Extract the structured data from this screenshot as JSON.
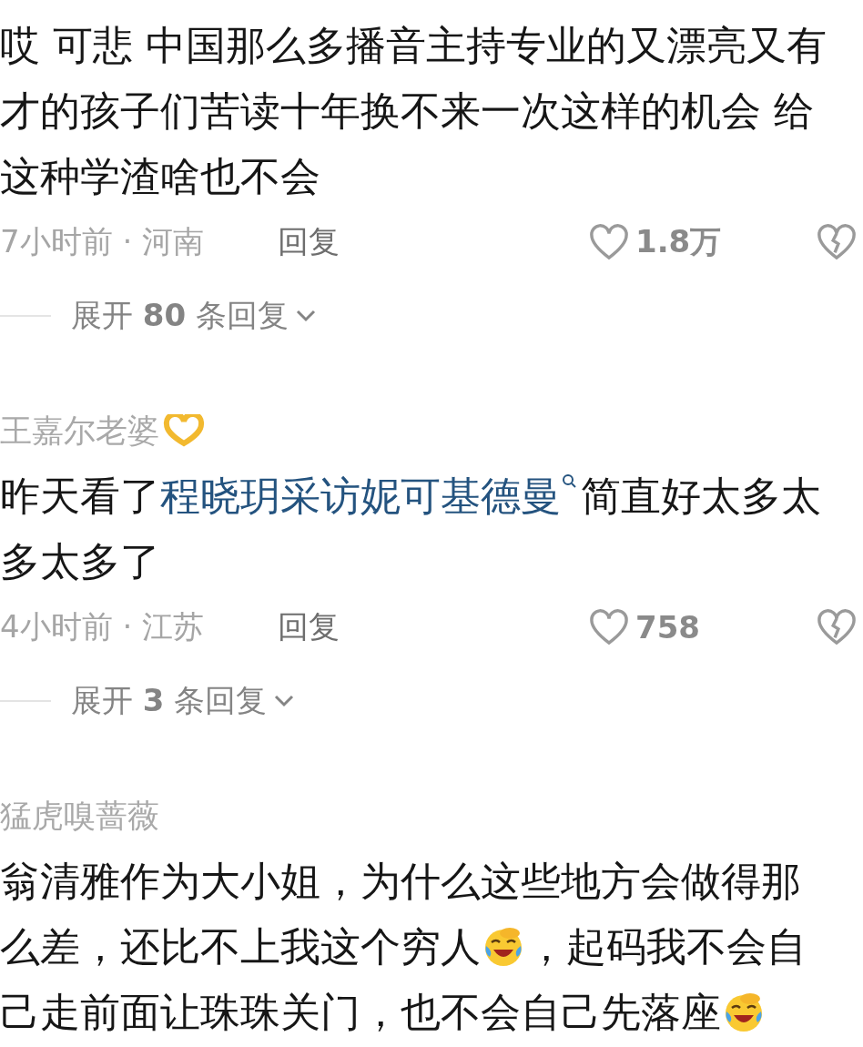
{
  "comments": [
    {
      "lines": [
        [
          {
            "kind": "text",
            "text": "哎 可悲 中国那么多播音主持专业的又漂亮又有"
          }
        ],
        [
          {
            "kind": "text",
            "text": "才的孩子们苦读十年换不来一次这样的机会 给"
          }
        ],
        [
          {
            "kind": "text",
            "text": "这种学渣啥也不会"
          }
        ]
      ],
      "meta": "7小时前 · 河南",
      "reply": "回复",
      "likes": "1.8万",
      "expand": "展开 **80** 条回复"
    },
    {
      "username": "王嘉尔老婆",
      "name_emoji": true,
      "lines": [
        [
          {
            "kind": "text",
            "text": "昨天看了"
          },
          {
            "kind": "link",
            "text": "程晓玥采访妮可基德曼"
          },
          {
            "kind": "text",
            "text": "简直好太多太"
          }
        ],
        [
          {
            "kind": "text",
            "text": "多太多了"
          }
        ]
      ],
      "meta": "4小时前 · 江苏",
      "reply": "回复",
      "likes": "758",
      "expand": "展开 **3** 条回复"
    },
    {
      "username": "猛虎嗅蔷薇",
      "lines": [
        [
          {
            "kind": "text",
            "text": "翁清雅作为大小姐，为什么这些地方会做得那"
          }
        ],
        [
          {
            "kind": "text",
            "text": "么差，还比不上我这个穷人"
          },
          {
            "kind": "emoji"
          },
          {
            "kind": "text",
            "text": "，起码我不会自"
          }
        ],
        [
          {
            "kind": "text",
            "text": "己走前面让珠珠关门，也不会自己先落座"
          },
          {
            "kind": "emoji"
          }
        ]
      ]
    }
  ]
}
